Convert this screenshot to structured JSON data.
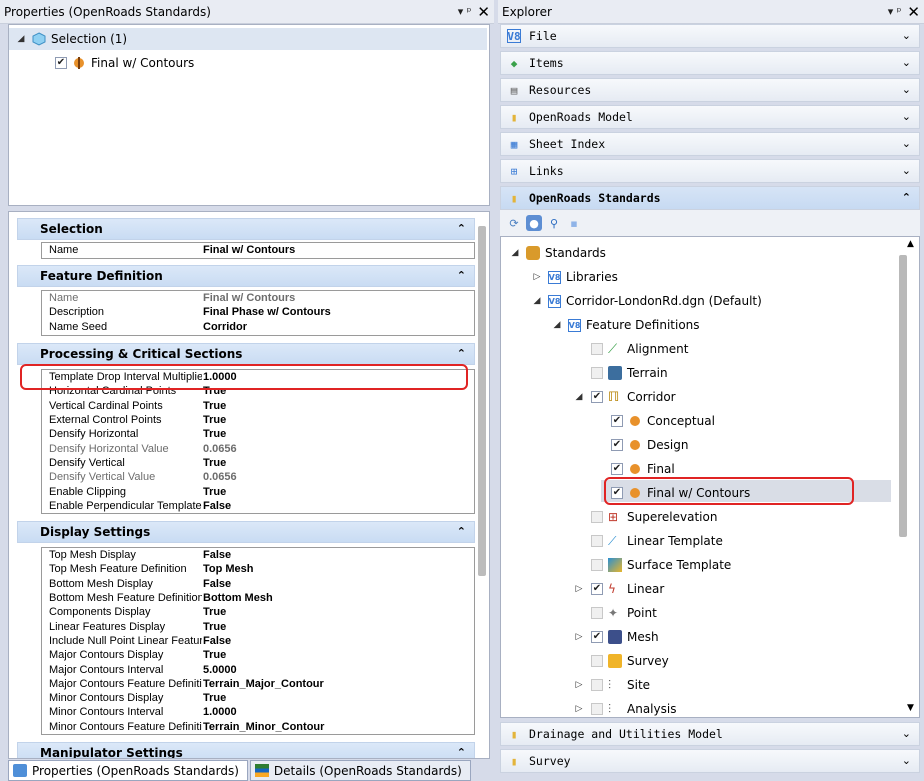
{
  "left_panel": {
    "title": "Properties (OpenRoads Standards)",
    "pin": "▾ ᵖ",
    "close": "✕",
    "selection_node": "Selection (1)",
    "selected_item": "Final w/ Contours"
  },
  "sections": {
    "selection": {
      "title": "Selection",
      "rows": [
        {
          "name": "Name",
          "value": "Final w/ Contours"
        }
      ]
    },
    "feature_definition": {
      "title": "Feature Definition",
      "rows": [
        {
          "name": "Name",
          "value": "Final w/ Contours"
        },
        {
          "name": "Description",
          "value": "Final Phase w/ Contours"
        },
        {
          "name": "Name Seed",
          "value": "Corridor"
        }
      ]
    },
    "processing": {
      "title": "Processing & Critical Sections",
      "rows": [
        {
          "name": "Template Drop Interval Multiplier",
          "value": "1.0000"
        },
        {
          "name": "Horizontal Cardinal Points",
          "value": "True"
        },
        {
          "name": "Vertical Cardinal Points",
          "value": "True"
        },
        {
          "name": "External Control Points",
          "value": "True"
        },
        {
          "name": "Densify Horizontal",
          "value": "True"
        },
        {
          "name": "Densify Horizontal Value",
          "value": "0.0656"
        },
        {
          "name": "Densify Vertical",
          "value": "True"
        },
        {
          "name": "Densify Vertical Value",
          "value": "0.0656"
        },
        {
          "name": "Enable Clipping",
          "value": "True"
        },
        {
          "name": "Enable Perpendicular Template Dr",
          "value": "False"
        }
      ]
    },
    "display": {
      "title": "Display Settings",
      "rows": [
        {
          "name": "Top Mesh Display",
          "value": "False"
        },
        {
          "name": "Top Mesh Feature Definition",
          "value": "Top Mesh"
        },
        {
          "name": "Bottom Mesh Display",
          "value": "False"
        },
        {
          "name": "Bottom Mesh Feature Definition",
          "value": "Bottom Mesh"
        },
        {
          "name": "Components Display",
          "value": "True"
        },
        {
          "name": "Linear Features Display",
          "value": "True"
        },
        {
          "name": "Include Null Point Linear Features",
          "value": "False"
        },
        {
          "name": "Major Contours Display",
          "value": "True"
        },
        {
          "name": "Major Contours Interval",
          "value": "5.0000"
        },
        {
          "name": "Major Contours Feature Definition",
          "value": "Terrain_Major_Contour"
        },
        {
          "name": "Minor Contours Display",
          "value": "True"
        },
        {
          "name": "Minor Contours Interval",
          "value": "1.0000"
        },
        {
          "name": "Minor Contours Feature Definition",
          "value": "Terrain_Minor_Contour"
        }
      ]
    },
    "manipulator": {
      "title": "Manipulator Settings"
    }
  },
  "tabs": [
    "Properties (OpenRoads Standards)",
    "Details (OpenRoads Standards)"
  ],
  "explorer": {
    "title": "Explorer",
    "accordions": [
      "File",
      "Items",
      "Resources",
      "OpenRoads Model",
      "Sheet Index",
      "Links",
      "OpenRoads Standards",
      "Drainage and Utilities Model",
      "Survey"
    ],
    "tree": {
      "standards": "Standards",
      "libraries": "Libraries",
      "dgn": "Corridor-LondonRd.dgn (Default)",
      "feature_definitions": "Feature Definitions",
      "alignment": "Alignment",
      "terrain": "Terrain",
      "corridor": "Corridor",
      "conceptual": "Conceptual",
      "design": "Design",
      "final": "Final",
      "final_contours": "Final w/ Contours",
      "superelevation": "Superelevation",
      "linear_template": "Linear Template",
      "surface_template": "Surface Template",
      "linear": "Linear",
      "point": "Point",
      "mesh": "Mesh",
      "survey": "Survey",
      "site": "Site",
      "analysis": "Analysis"
    }
  },
  "colors": {
    "highlight": "#e02424",
    "header": "#c9dcf3",
    "accent": "#3a7bd5"
  }
}
